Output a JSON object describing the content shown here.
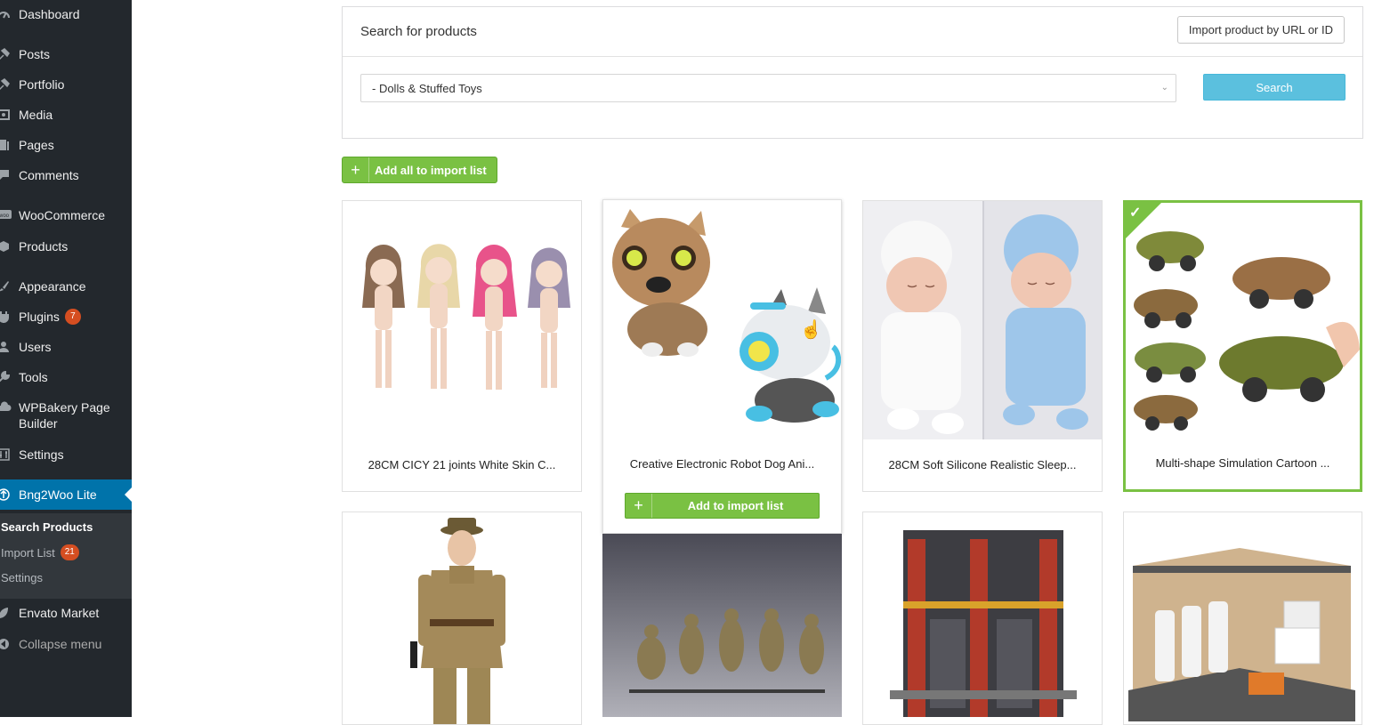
{
  "sidebar": {
    "items": [
      {
        "label": "Dashboard",
        "icon": "dashboard-icon"
      },
      {
        "label": "Posts",
        "icon": "pin-icon"
      },
      {
        "label": "Portfolio",
        "icon": "pin-icon"
      },
      {
        "label": "Media",
        "icon": "media-icon"
      },
      {
        "label": "Pages",
        "icon": "pages-icon"
      },
      {
        "label": "Comments",
        "icon": "comment-icon"
      },
      {
        "label": "WooCommerce",
        "icon": "woo-icon"
      },
      {
        "label": "Products",
        "icon": "box-icon"
      },
      {
        "label": "Appearance",
        "icon": "brush-icon"
      },
      {
        "label": "Plugins",
        "icon": "plugin-icon",
        "badge": "7"
      },
      {
        "label": "Users",
        "icon": "user-icon"
      },
      {
        "label": "Tools",
        "icon": "wrench-icon"
      },
      {
        "label": "WPBakery Page Builder",
        "icon": "cloud-icon"
      },
      {
        "label": "Settings",
        "icon": "sliders-icon"
      },
      {
        "label": "Bng2Woo Lite",
        "icon": "globe-icon"
      },
      {
        "label": "Envato Market",
        "icon": "leaf-icon"
      },
      {
        "label": "Collapse menu",
        "icon": "collapse-icon"
      }
    ],
    "submenu": [
      {
        "label": "Search Products"
      },
      {
        "label": "Import List",
        "badge": "21"
      },
      {
        "label": "Settings"
      }
    ]
  },
  "search": {
    "title": "Search for products",
    "import_button": "Import product by URL or ID",
    "category_value": "- Dolls & Stuffed Toys",
    "search_button": "Search"
  },
  "add_all_label": "Add all to import list",
  "add_label": "Add to import list",
  "products": [
    {
      "title": "28CM CICY 21 joints White Skin C..."
    },
    {
      "title": "Creative Electronic Robot Dog Ani..."
    },
    {
      "title": "28CM Soft Silicone Realistic Sleep..."
    },
    {
      "title": "Multi-shape Simulation Cartoon ..."
    }
  ],
  "colors": {
    "sidebar_bg": "#23282d",
    "active_bg": "#0073aa",
    "green": "#7ac143",
    "search_blue": "#5bc0de",
    "badge": "#d54e21"
  }
}
